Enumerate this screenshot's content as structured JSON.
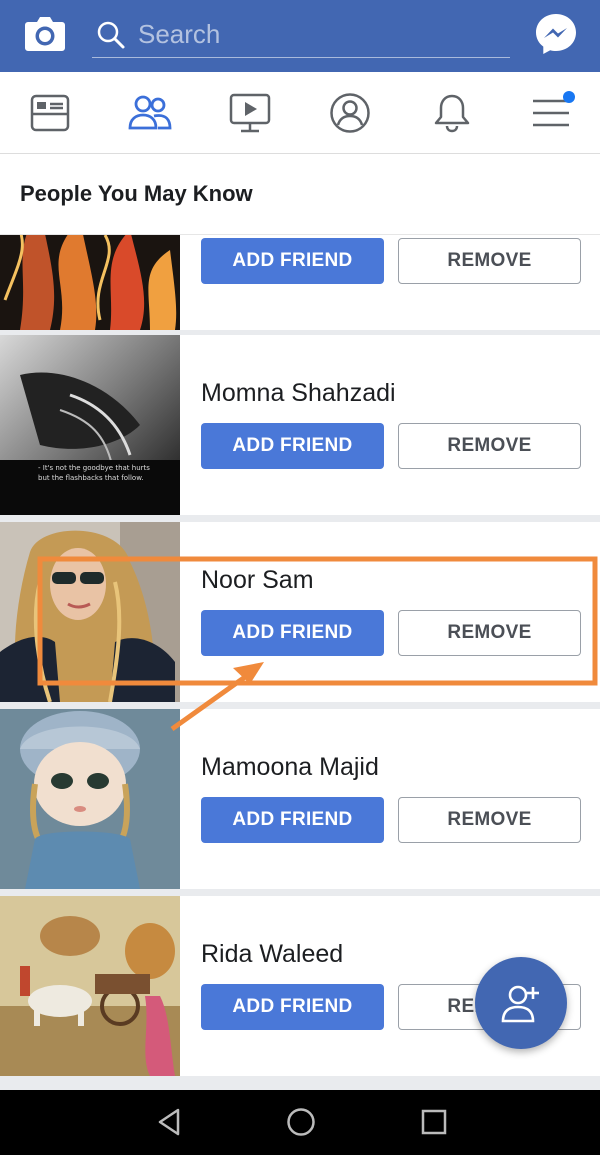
{
  "header": {
    "search_placeholder": "Search",
    "icons": [
      "camera-icon",
      "search-icon",
      "messenger-icon"
    ],
    "color": "#4267b2"
  },
  "nav": {
    "icons": [
      "news-feed-icon",
      "friends-icon",
      "watch-icon",
      "profile-icon",
      "notifications-icon",
      "menu-icon"
    ],
    "active": "friends-icon",
    "badge_color": "#1877f2"
  },
  "section": {
    "title": "People You May Know"
  },
  "people": [
    {
      "name": "",
      "add_label": "ADD FRIEND",
      "remove_label": "REMOVE"
    },
    {
      "name": "Momna Shahzadi",
      "add_label": "ADD FRIEND",
      "remove_label": "REMOVE",
      "photo_caption_1": "- It's not the goodbye that hurts",
      "photo_caption_2": "but the flashbacks that follow."
    },
    {
      "name": "Noor Sam",
      "add_label": "ADD FRIEND",
      "remove_label": "REMOVE"
    },
    {
      "name": "Mamoona Majid",
      "add_label": "ADD FRIEND",
      "remove_label": "REMOVE"
    },
    {
      "name": "Rida Waleed",
      "add_label": "ADD FRIEND",
      "remove_label": "REMOVE"
    }
  ],
  "fab": {
    "icon": "add-person-icon"
  },
  "system_nav": {
    "icons": [
      "back-icon",
      "home-icon",
      "recents-icon"
    ]
  },
  "colors": {
    "add_button": "#4a78d8",
    "annotation": "#f08a3c"
  }
}
